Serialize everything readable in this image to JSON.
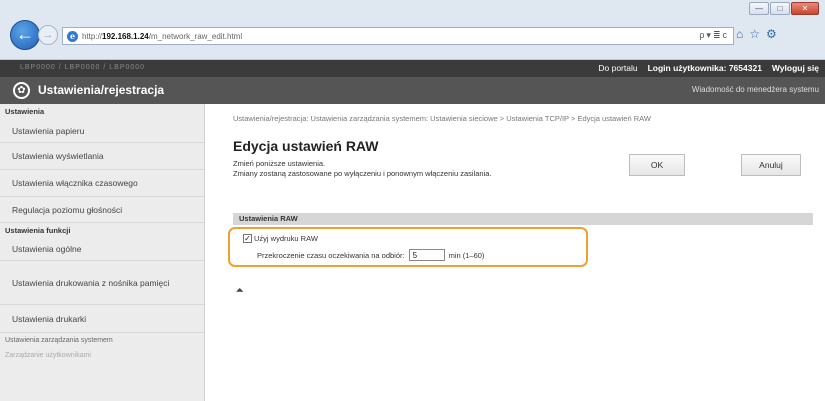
{
  "browser": {
    "url_prefix": "http://",
    "url_host": "192.168.1.24",
    "url_path": "/m_network_raw_edit.html",
    "address_tools": "ρ▾≣c",
    "window_buttons": [
      "—",
      "□",
      "✕"
    ],
    "tab_icons": [
      "⌂",
      "☆",
      "⚙"
    ]
  },
  "topbar": {
    "model": "LBP0000 / LBP0000 / LBP0000",
    "portal_link": "Do portalu",
    "login_label": "Login użytkownika:",
    "login_value": "7654321",
    "logout_link": "Wyloguj się"
  },
  "header": {
    "title": "Ustawienia/rejestracja",
    "message_link": "Wiadomość do menedżera systemu"
  },
  "sidebar": {
    "section_settings": "Ustawienia",
    "items": [
      "Ustawienia papieru",
      "Ustawienia wyświetlania",
      "Ustawienia włącznika czasowego",
      "Regulacja poziomu głośności"
    ],
    "section_functions": "Ustawienia funkcji",
    "function_items": [
      "Ustawienia ogólne",
      "Ustawienia drukowania z nośnika pamięci",
      "Ustawienia drukarki"
    ],
    "section_system": "Ustawienia zarządzania systemem",
    "system_item": "Zarządzanie użytkownikami"
  },
  "main": {
    "breadcrumb": "Ustawienia/rejestracja: Ustawienia zarządzania systemem: Ustawienia sieciowe > Ustawienia TCP/IP > Edycja ustawień RAW",
    "page_title": "Edycja ustawień RAW",
    "note_line1": "Zmień poniższe ustawienia.",
    "note_line2": "Zmiany zostaną zastosowane po wyłączeniu i ponownym włączeniu zasilania.",
    "ok_label": "OK",
    "cancel_label": "Anuluj",
    "section_title": "Ustawienia RAW",
    "checkbox_label": "Użyj wydruku RAW",
    "checkbox_checked": true,
    "timeout_label": "Przekroczenie czasu oczekiwania na odbiór:",
    "timeout_value": "5",
    "timeout_unit": "min (1–60)",
    "top_icon": "⏶"
  }
}
